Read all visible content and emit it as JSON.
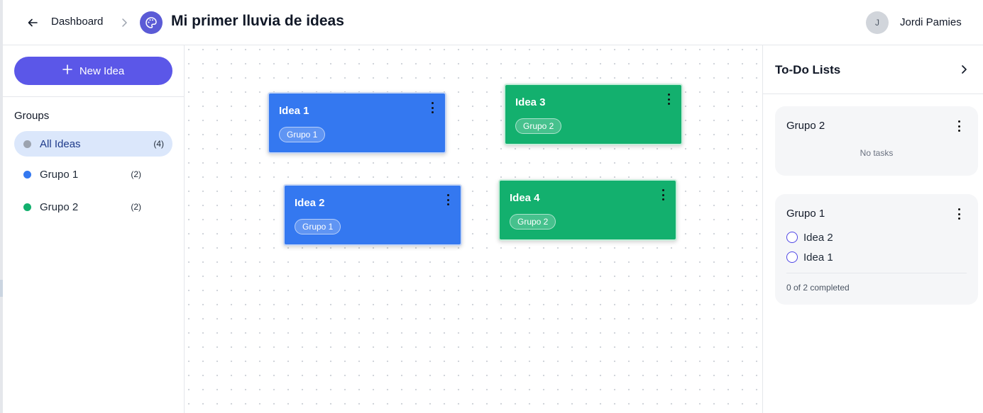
{
  "header": {
    "breadcrumb_label": "Dashboard",
    "board_title": "Mi primer lluvia de ideas",
    "board_icon": "palette-icon",
    "user_initial": "J",
    "user_name": "Jordi Pamies"
  },
  "sidebar": {
    "new_idea_label": "New Idea",
    "groups_heading": "Groups",
    "groups": [
      {
        "label": "All Ideas",
        "count": "(4)",
        "color": "#9ca3af",
        "active": true
      },
      {
        "label": "Grupo 1",
        "count": "(2)",
        "color": "#3478f0",
        "active": false
      },
      {
        "label": "Grupo 2",
        "count": "(2)",
        "color": "#13b06e",
        "active": false
      }
    ]
  },
  "canvas": {
    "ideas": [
      {
        "title": "Idea 1",
        "group": "Grupo 1",
        "color": "#3478f0"
      },
      {
        "title": "Idea 3",
        "group": "Grupo 2",
        "color": "#13b06e"
      },
      {
        "title": "Idea 2",
        "group": "Grupo 1",
        "color": "#3478f0"
      },
      {
        "title": "Idea 4",
        "group": "Grupo 2",
        "color": "#13b06e"
      }
    ]
  },
  "todo": {
    "title": "To-Do Lists",
    "lists": [
      {
        "title": "Grupo 2",
        "empty_text": "No tasks",
        "tasks": []
      },
      {
        "title": "Grupo 1",
        "tasks": [
          "Idea 2",
          "Idea 1"
        ],
        "progress": "0 of 2 completed"
      }
    ]
  },
  "colors": {
    "accent": "#5b57e8",
    "blue_group": "#3478f0",
    "green_group": "#13b06e"
  }
}
